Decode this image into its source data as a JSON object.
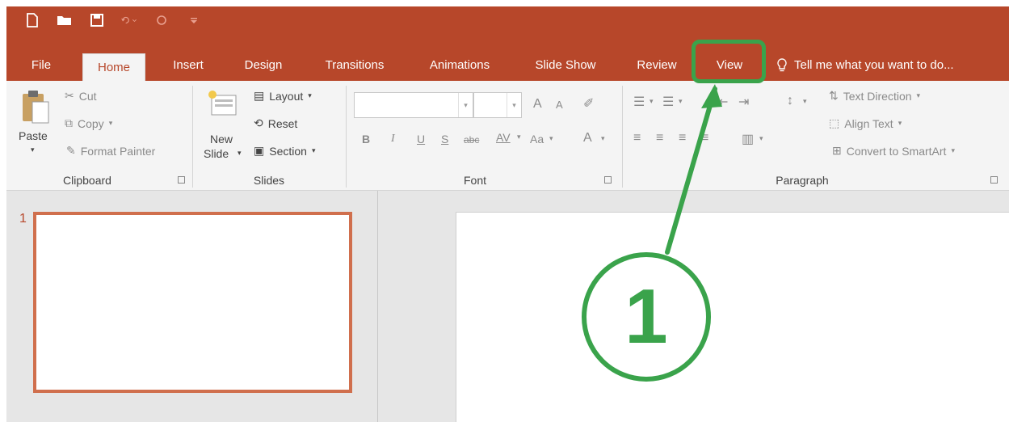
{
  "ribbon_tabs": [
    {
      "label": "File"
    },
    {
      "label": "Home"
    },
    {
      "label": "Insert"
    },
    {
      "label": "Design"
    },
    {
      "label": "Transitions"
    },
    {
      "label": "Animations"
    },
    {
      "label": "Slide Show"
    },
    {
      "label": "Review"
    },
    {
      "label": "View"
    }
  ],
  "tell_me": "Tell me what you want to do...",
  "clipboard": {
    "paste": "Paste",
    "cut": "Cut",
    "copy": "Copy",
    "format_painter": "Format Painter",
    "label": "Clipboard"
  },
  "slides_group": {
    "new_slide_line1": "New",
    "new_slide_line2": "Slide",
    "layout": "Layout",
    "reset": "Reset",
    "section": "Section",
    "label": "Slides"
  },
  "font_group": {
    "bold": "B",
    "italic": "I",
    "underline": "U",
    "strike": "S",
    "abc": "abc",
    "spacing": "AV",
    "change_case": "Aa",
    "font_color": "A",
    "grow": "A",
    "shrink": "A",
    "label": "Font"
  },
  "paragraph_group": {
    "text_direction": "Text Direction",
    "align_text": "Align Text",
    "convert_smartart": "Convert to SmartArt",
    "label": "Paragraph"
  },
  "thumbnail": {
    "number": "1"
  },
  "annotation": {
    "step": "1"
  },
  "colors": {
    "accent": "#b7472a",
    "highlight": "#3aa34b"
  }
}
